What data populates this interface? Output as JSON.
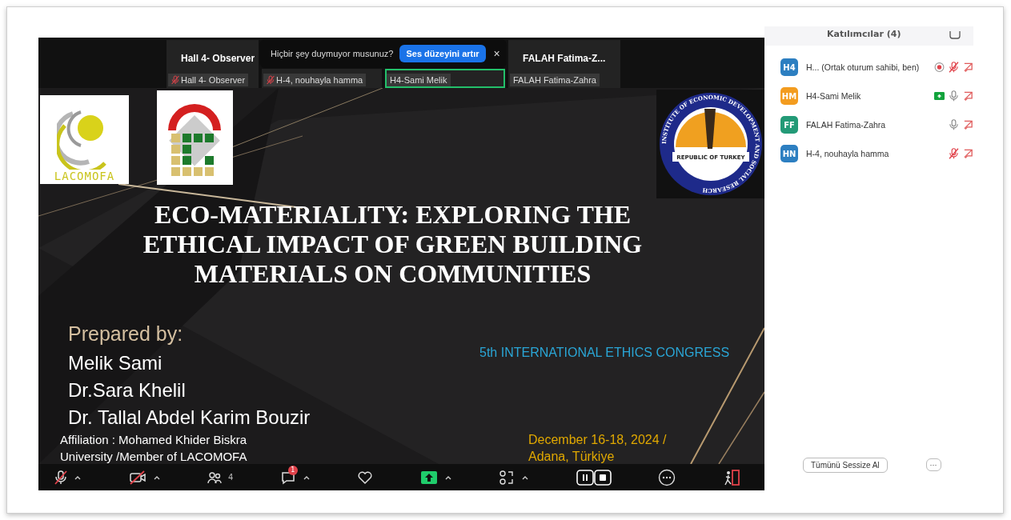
{
  "thumbnails": [
    {
      "name": "Hall 4- Observer",
      "label": "Hall 4- Observer",
      "muted": true,
      "selected": false
    },
    {
      "label": "H-4, nouhayla hamma",
      "muted": true,
      "selected": false
    },
    {
      "label": "H4-Sami Melik",
      "muted": false,
      "selected": true
    },
    {
      "name": "FALAH Fatima-Z...",
      "label": "FALAH Fatima-Zahra",
      "muted": false,
      "selected": false
    }
  ],
  "toast": {
    "message": "Hiçbir şey duymuyor musunuz?",
    "button": "Ses düzeyini artır",
    "close": "×"
  },
  "slide": {
    "logo_text": "LACOMOFA",
    "seal_top": "INSTITUTE OF ECONOMIC DEVELOPMENT AND SOCIAL RESEARCH",
    "seal_center": "REPUBLIC OF TURKEY",
    "title": "ECO-MATERIALITY: EXPLORING THE ETHICAL IMPACT OF GREEN BUILDING MATERIALS ON COMMUNITIES",
    "prepared_by": "Prepared by:",
    "authors": [
      "Melik Sami",
      "Dr.Sara Khelil",
      "Dr. Tallal Abdel Karim Bouzir"
    ],
    "affiliation": "Affiliation : Mohamed Khider Biskra University /Member of LACOMOFA",
    "congress": "5th INTERNATIONAL ETHICS CONGRESS",
    "date_place": "December 16-18, 2024 / Adana, Türkiye"
  },
  "toolbar": {
    "mic_muted": true,
    "video_off": true,
    "participant_count": "4",
    "chat_badge": "1"
  },
  "participants_panel": {
    "title": "Katılımcılar (4)",
    "participants": [
      {
        "initials": "H4",
        "color": "#2d7fc1",
        "name": "H... (Ortak oturum sahibi, ben)",
        "recording": true,
        "sharing": false,
        "muted": true
      },
      {
        "initials": "HM",
        "color": "#f39c1f",
        "name": "H4-Sami Melik",
        "recording": false,
        "sharing": true,
        "muted": false
      },
      {
        "initials": "FF",
        "color": "#239a77",
        "name": "FALAH Fatima-Zahra",
        "recording": false,
        "sharing": false,
        "muted": false
      },
      {
        "initials": "HN",
        "color": "#2d7fc1",
        "name": "H-4, nouhayla hamma",
        "recording": false,
        "sharing": false,
        "muted": true
      }
    ],
    "mute_all": "Tümünü Sessize Al",
    "more": "···"
  }
}
